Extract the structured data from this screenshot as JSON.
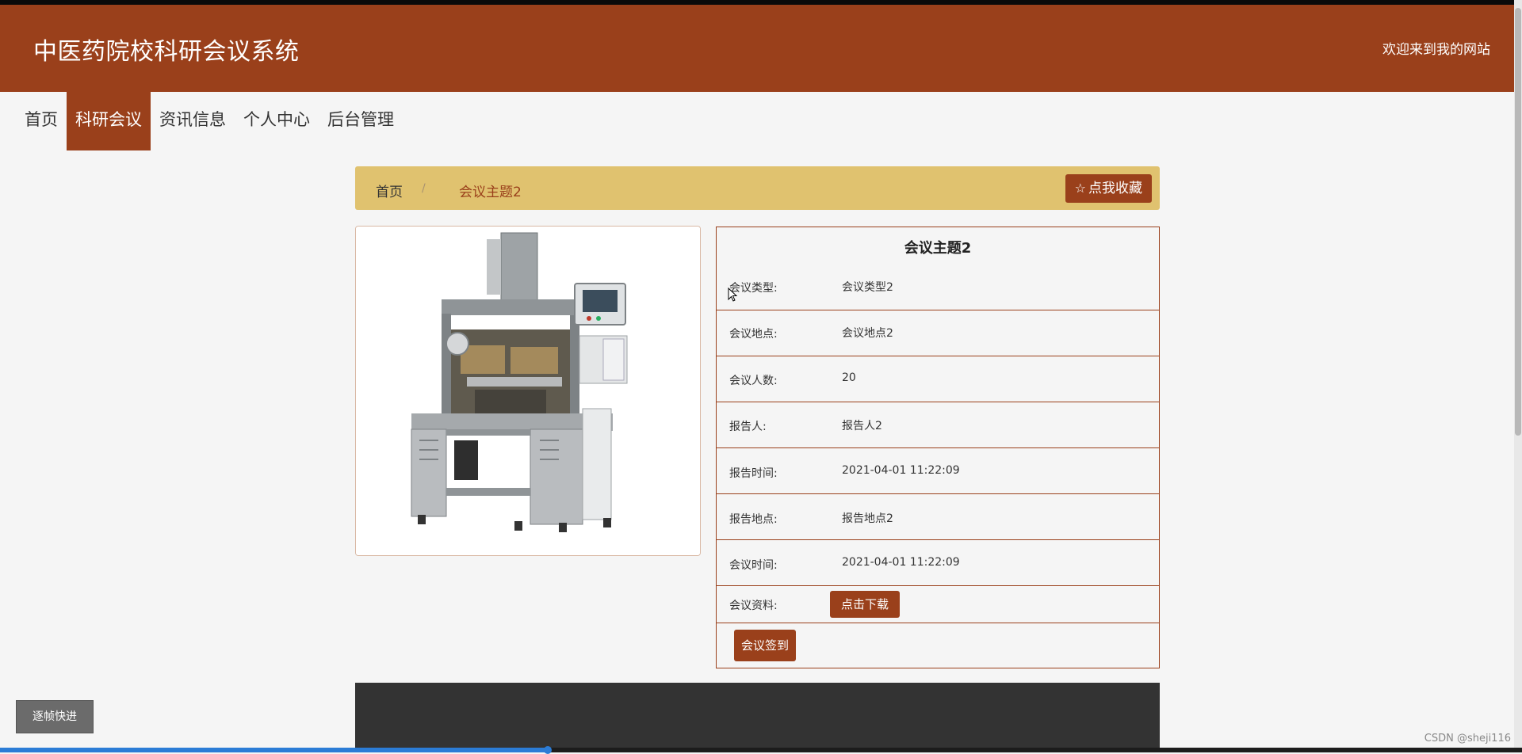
{
  "header": {
    "site_title": "中医药院校科研会议系统",
    "welcome": "欢迎来到我的网站"
  },
  "nav": {
    "items": [
      {
        "label": "首页"
      },
      {
        "label": "科研会议"
      },
      {
        "label": "资讯信息"
      },
      {
        "label": "个人中心"
      },
      {
        "label": "后台管理"
      }
    ],
    "active_index": 1
  },
  "breadcrumb": {
    "home": "首页",
    "separator": "/",
    "current": "会议主题2",
    "collect_label": "点我收藏",
    "collect_icon": "star-outline-icon"
  },
  "detail": {
    "title": "会议主题2",
    "fields": [
      {
        "label": "会议类型:",
        "value": "会议类型2"
      },
      {
        "label": "会议地点:",
        "value": "会议地点2"
      },
      {
        "label": "会议人数:",
        "value": "20"
      },
      {
        "label": "报告人:",
        "value": "报告人2"
      },
      {
        "label": "报告时间:",
        "value": "2021-04-01 11:22:09"
      },
      {
        "label": "报告地点:",
        "value": "报告地点2"
      },
      {
        "label": "会议时间:",
        "value": "2021-04-01 11:22:09"
      }
    ],
    "material_label": "会议资料:",
    "download_label": "点击下载",
    "signin_label": "会议签到"
  },
  "image": {
    "subject": "machine-product-image"
  },
  "overlay": {
    "step_button": "逐帧快进",
    "watermark": "CSDN @sheji116",
    "video_progress": 0.36
  },
  "colors": {
    "brand": "#9a401b",
    "breadcrumb_bg": "#e0c26f",
    "page_bg": "#f5f5f5",
    "footer_bg": "#333333"
  }
}
